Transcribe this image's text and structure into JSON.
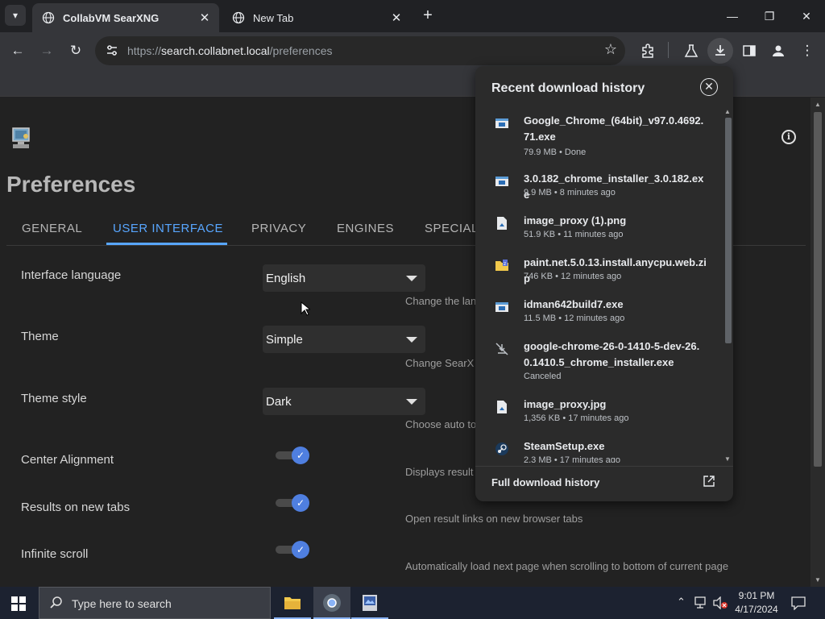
{
  "browser": {
    "tabs": [
      {
        "title": "CollabVM SearXNG",
        "active": true
      },
      {
        "title": "New Tab",
        "active": false
      }
    ],
    "new_tab_glyph": "+",
    "url": {
      "scheme": "https://",
      "host": "search.collabnet.local",
      "path": "/preferences"
    },
    "window_controls": [
      "minimize-icon",
      "restore-icon",
      "close-icon"
    ],
    "toolbar_icons": [
      "back-icon",
      "forward-icon",
      "reload-icon",
      "site-info-icon",
      "bookmark-star-icon",
      "extensions-icon",
      "labs-flask-icon",
      "download-icon",
      "side-panel-icon",
      "profile-icon",
      "menu-dots-icon"
    ]
  },
  "page": {
    "title": "Preferences",
    "tabs": [
      "GENERAL",
      "USER INTERFACE",
      "PRIVACY",
      "ENGINES",
      "SPECIAL"
    ],
    "selected_tab": "USER INTERFACE",
    "settings": [
      {
        "label": "Interface language",
        "type": "select",
        "value": "English",
        "description": "Change the lan"
      },
      {
        "label": "Theme",
        "type": "select",
        "value": "Simple",
        "description": "Change SearX"
      },
      {
        "label": "Theme style",
        "type": "select",
        "value": "Dark",
        "description": "Choose auto to"
      },
      {
        "label": "Center Alignment",
        "type": "toggle",
        "on": true,
        "description": "Displays result"
      },
      {
        "label": "Results on new tabs",
        "type": "toggle",
        "on": true,
        "description": "Open result links on new browser tabs"
      },
      {
        "label": "Infinite scroll",
        "type": "toggle",
        "on": true,
        "description": "Automatically load next page when scrolling to bottom of current page"
      }
    ]
  },
  "downloads": {
    "title": "Recent download history",
    "items": [
      {
        "name": "Google_Chrome_(64bit)_v97.0.4692.71.exe",
        "meta": "79.9 MB • Done",
        "icon": "exe-file-icon"
      },
      {
        "name": "3.0.182_chrome_installer_3.0.182.exe",
        "meta": "9.9 MB • 8 minutes ago",
        "icon": "exe-file-icon"
      },
      {
        "name": "image_proxy (1).png",
        "meta": "51.9 KB • 11 minutes ago",
        "icon": "image-file-icon"
      },
      {
        "name": "paint.net.5.0.13.install.anycpu.web.zip",
        "meta": "746 KB • 12 minutes ago",
        "icon": "zip-folder-icon"
      },
      {
        "name": "idman642build7.exe",
        "meta": "11.5 MB • 12 minutes ago",
        "icon": "exe-file-icon"
      },
      {
        "name": "google-chrome-26-0-1410-5-dev-26.0.1410.5_chrome_installer.exe",
        "meta": "Canceled",
        "icon": "canceled-download-icon"
      },
      {
        "name": "image_proxy.jpg",
        "meta": "1,356 KB • 17 minutes ago",
        "icon": "image-file-icon"
      },
      {
        "name": "SteamSetup.exe",
        "meta": "2.3 MB • 17 minutes ago",
        "icon": "steam-icon"
      }
    ],
    "footer": "Full download history"
  },
  "taskbar": {
    "search_placeholder": "Type here to search",
    "time": "9:01 PM",
    "date": "4/17/2024",
    "apps": [
      "file-explorer-icon",
      "chrome-icon",
      "app-icon"
    ]
  },
  "colors": {
    "accent": "#58a6ff",
    "toggle_on": "#4f7fe0",
    "page_bg": "#222222",
    "panel_bg": "#2b2b2b"
  }
}
